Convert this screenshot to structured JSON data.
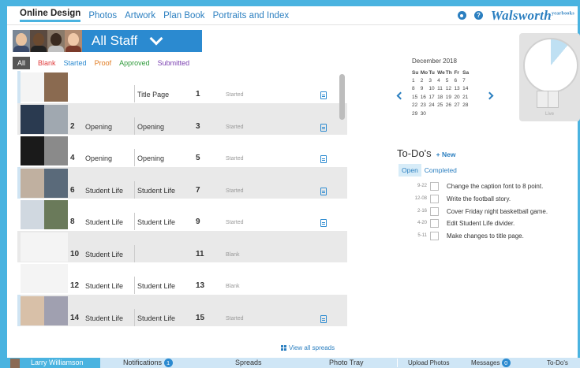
{
  "nav": {
    "tabs": [
      "Online Design",
      "Photos",
      "Artwork",
      "Plan Book",
      "Portraits and Index"
    ],
    "logo": "Walsworth",
    "logo_sup": "yearbooks"
  },
  "staff": {
    "name": "All Staff"
  },
  "filters": [
    "All",
    "Blank",
    "Started",
    "Proof",
    "Approved",
    "Submitted"
  ],
  "filter_colors": [
    "#555555",
    "#e03c3c",
    "#2b8ad0",
    "#e07a1f",
    "#2e9a3a",
    "#7a3fb0"
  ],
  "spreads": [
    {
      "lp": "",
      "ls": "",
      "rs": "Title Page",
      "rp": "1",
      "status": "Started",
      "gray": false,
      "sel": true
    },
    {
      "lp": "2",
      "ls": "Opening",
      "rs": "Opening",
      "rp": "3",
      "status": "Started",
      "gray": true,
      "sel": false
    },
    {
      "lp": "4",
      "ls": "Opening",
      "rs": "Opening",
      "rp": "5",
      "status": "Started",
      "gray": false,
      "sel": false
    },
    {
      "lp": "6",
      "ls": "Student Life",
      "rs": "Student Life",
      "rp": "7",
      "status": "Started",
      "gray": true,
      "sel": true
    },
    {
      "lp": "8",
      "ls": "Student Life",
      "rs": "Student Life",
      "rp": "9",
      "status": "Started",
      "gray": false,
      "sel": false
    },
    {
      "lp": "10",
      "ls": "Student Life",
      "rs": "",
      "rp": "11",
      "status": "Blank",
      "gray": true,
      "sel": false
    },
    {
      "lp": "12",
      "ls": "Student Life",
      "rs": "Student Life",
      "rp": "13",
      "status": "Blank",
      "gray": false,
      "sel": false
    },
    {
      "lp": "14",
      "ls": "Student Life",
      "rs": "Student Life",
      "rp": "15",
      "status": "Started",
      "gray": true,
      "sel": true
    }
  ],
  "view_all": "View all spreads",
  "calendar": {
    "month": "December 2018",
    "days": [
      "Su",
      "Mo",
      "Tu",
      "We",
      "Th",
      "Fr",
      "Sa"
    ],
    "weeks": [
      [
        "1",
        "2",
        "3",
        "4",
        "5",
        "6",
        "7"
      ],
      [
        "8",
        "9",
        "10",
        "11",
        "12",
        "13",
        "14"
      ],
      [
        "15",
        "16",
        "17",
        "18",
        "19",
        "20",
        "21"
      ],
      [
        "22",
        "23",
        "24",
        "25",
        "26",
        "27",
        "28"
      ],
      [
        "29",
        "30",
        "",
        "",
        "",
        "",
        ""
      ]
    ]
  },
  "live": {
    "label": "Live",
    "progress": 0.11
  },
  "todo": {
    "title": "To-Do's",
    "new": "+ New",
    "tabs": [
      "Open",
      "Completed"
    ],
    "items": [
      {
        "date": "9-22",
        "text": "Change the caption font to 8 point."
      },
      {
        "date": "12-08",
        "text": "Write the football story."
      },
      {
        "date": "2-16",
        "text": "Cover Friday night basketball game."
      },
      {
        "date": "4-20",
        "text": "Edit Student Life divider."
      },
      {
        "date": "5-11",
        "text": "Make changes to title page."
      }
    ]
  },
  "bottom": {
    "user": "Larry Williamson",
    "notifications": "Notifications",
    "notifications_count": "1",
    "spreads": "Spreads",
    "photo_tray": "Photo Tray",
    "upload": "Upload Photos",
    "messages": "Messages",
    "messages_count": "0",
    "todos": "To-Do's"
  }
}
